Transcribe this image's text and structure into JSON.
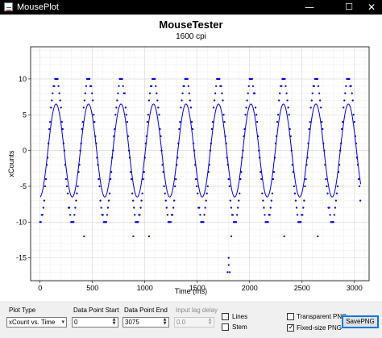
{
  "window": {
    "title": "MousePlot",
    "min_glyph": "—",
    "max_glyph": "☐",
    "close_glyph": "✕"
  },
  "chart_data": {
    "type": "scatter",
    "title": "MouseTester",
    "subtitle": "1600 cpi",
    "xlabel": "Time (ms)",
    "ylabel": "xCounts",
    "xlim": [
      -90,
      3140
    ],
    "ylim": [
      -18.2,
      14.5
    ],
    "xticks": [
      0,
      500,
      1000,
      1500,
      2000,
      2500,
      3000
    ],
    "yticks": [
      -15,
      -10,
      -5,
      0,
      5,
      10
    ],
    "grid": true,
    "series_color": "#0000cd",
    "series": [
      {
        "kind": "points",
        "wave": {
          "period_ms": 310,
          "phase_ms": 75,
          "amplitude_counts": 10,
          "x_start_ms": 0,
          "x_end_ms": 3060,
          "sample_step_ms": 8
        }
      },
      {
        "kind": "line",
        "smoothed": true,
        "wave": {
          "period_ms": 310,
          "phase_ms": 75,
          "amplitude_counts": 6.5,
          "x_start_ms": 0,
          "x_end_ms": 3060
        }
      }
    ],
    "outliers": [
      {
        "x": 1800,
        "y": -15
      },
      {
        "x": 1800,
        "y": -16
      },
      {
        "x": 1810,
        "y": -17
      },
      {
        "x": 1790,
        "y": -17
      },
      {
        "x": 1825,
        "y": -12
      },
      {
        "x": 1040,
        "y": -12
      },
      {
        "x": 890,
        "y": -12
      },
      {
        "x": 420,
        "y": -12
      },
      {
        "x": 2330,
        "y": -12
      },
      {
        "x": 2650,
        "y": -12
      }
    ]
  },
  "controls": {
    "plot_type_label": "Plot Type",
    "plot_type_value": "xCount vs. Time",
    "start_label": "Data Point Start",
    "start_value": "0",
    "end_label": "Data Point End",
    "end_value": "3075",
    "lag_label": "Input lag delay",
    "lag_value": "0.0",
    "lines_label": "Lines",
    "lines_checked": false,
    "stem_label": "Stem",
    "stem_checked": false,
    "transparent_label": "Transparent PNG",
    "transparent_checked": false,
    "fixed_label": "Fixed-size PNG",
    "fixed_checked": true,
    "check_glyph": "✓",
    "save_label": "SavePNG",
    "dropdown_glyph": "▾",
    "spin_up": "▲",
    "spin_down": "▼"
  }
}
